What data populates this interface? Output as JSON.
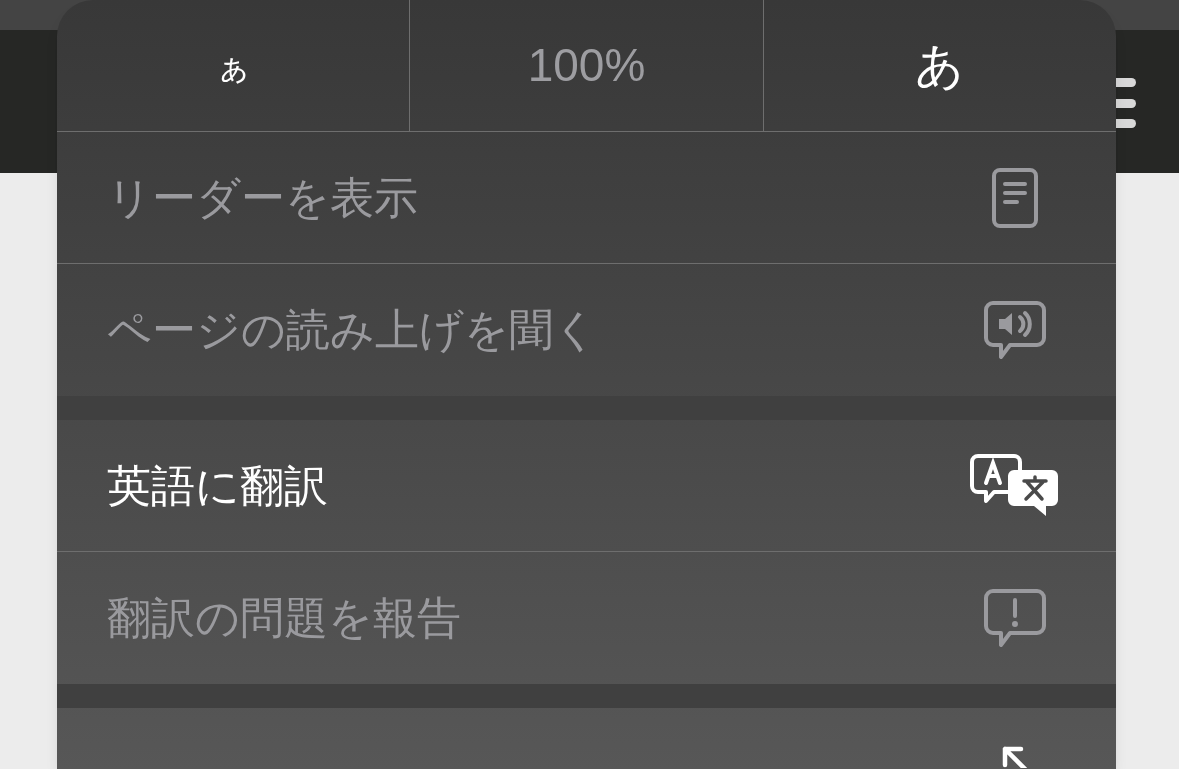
{
  "zoom_bar": {
    "decrease": "ぁ",
    "level": "100%",
    "increase": "あ"
  },
  "menu_groups": [
    [
      {
        "label": "リーダーを表示",
        "kind": "reader",
        "disabled": true
      },
      {
        "label": "ページの読み上げを聞く",
        "kind": "speak",
        "disabled": true
      }
    ],
    [
      {
        "label": "英語に翻訳",
        "kind": "translate",
        "disabled": false
      },
      {
        "label": "翻訳の問題を報告",
        "kind": "report",
        "disabled": true
      }
    ],
    [
      {
        "kind": "toolbar",
        "disabled": false
      }
    ]
  ]
}
